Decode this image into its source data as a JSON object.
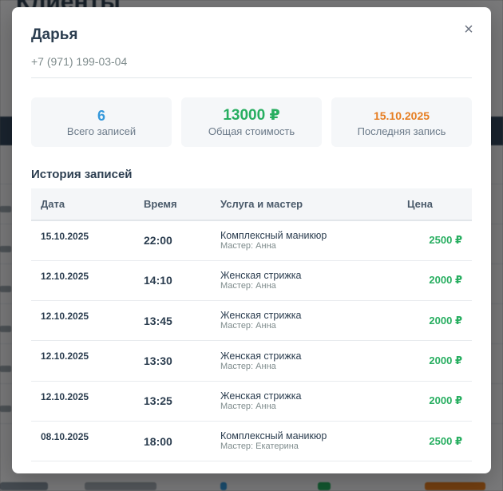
{
  "background": {
    "title": "Клиенты"
  },
  "modal": {
    "close_label": "×",
    "client_name": "Дарья",
    "client_phone": "+7 (971) 199-03-04",
    "stats": [
      {
        "value": "6",
        "label": "Всего записей"
      },
      {
        "value": "13000 ₽",
        "label": "Общая стоимость"
      },
      {
        "value": "15.10.2025",
        "label": "Последняя запись"
      }
    ],
    "history_title": "История записей",
    "table": {
      "headers": [
        "Дата",
        "Время",
        "Услуга и мастер",
        "Цена"
      ],
      "rows": [
        {
          "date": "15.10.2025",
          "time": "22:00",
          "service": "Комплексный маникюр",
          "master": "Мастер: Анна",
          "price": "2500 ₽"
        },
        {
          "date": "12.10.2025",
          "time": "14:10",
          "service": "Женская стрижка",
          "master": "Мастер: Анна",
          "price": "2000 ₽"
        },
        {
          "date": "12.10.2025",
          "time": "13:45",
          "service": "Женская стрижка",
          "master": "Мастер: Анна",
          "price": "2000 ₽"
        },
        {
          "date": "12.10.2025",
          "time": "13:30",
          "service": "Женская стрижка",
          "master": "Мастер: Анна",
          "price": "2000 ₽"
        },
        {
          "date": "12.10.2025",
          "time": "13:25",
          "service": "Женская стрижка",
          "master": "Мастер: Анна",
          "price": "2000 ₽"
        },
        {
          "date": "08.10.2025",
          "time": "18:00",
          "service": "Комплексный маникюр",
          "master": "Мастер: Екатерина",
          "price": "2500 ₽"
        }
      ]
    }
  },
  "colors": {
    "accent_blue": "#3498db",
    "accent_green": "#27ae60",
    "accent_orange": "#e67e22",
    "text_dark": "#2c3e50"
  }
}
